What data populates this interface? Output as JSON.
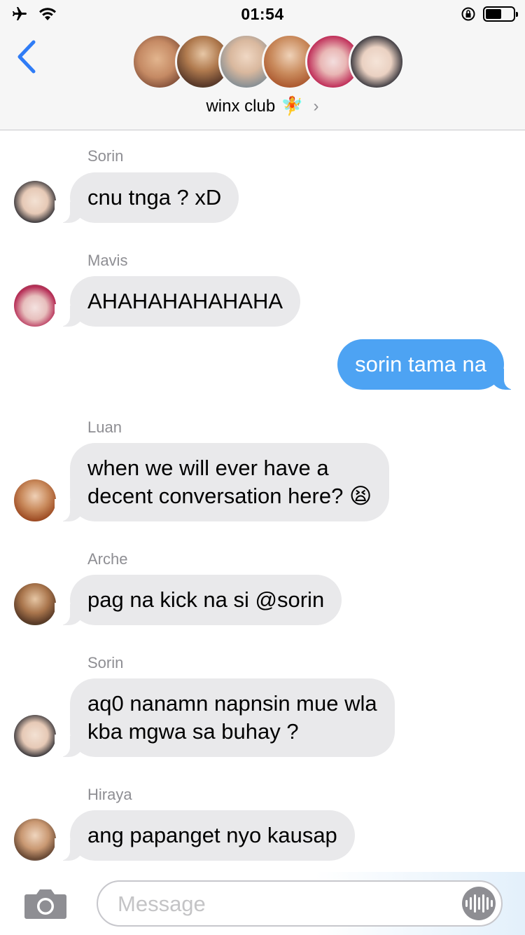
{
  "status_bar": {
    "time": "01:54",
    "icons": [
      "airplane-icon",
      "wifi-icon",
      "orientation-lock-icon",
      "battery-icon"
    ],
    "battery_level": 0.5
  },
  "header": {
    "group_name": "winx club",
    "group_emoji": "🧚",
    "chevron": "›",
    "member_count_shown": 6
  },
  "messages": [
    {
      "sender": "Sorin",
      "text": "cnu tnga ? xD",
      "direction": "incoming"
    },
    {
      "sender": "Mavis",
      "text": "AHAHAHAHAHAHA",
      "direction": "incoming"
    },
    {
      "sender": "",
      "text": "sorin tama na",
      "direction": "outgoing"
    },
    {
      "sender": "Luan",
      "text_line1": "when we will ever have a",
      "text_line2": "decent conversation here? 😫",
      "direction": "incoming"
    },
    {
      "sender": "Arche",
      "text": "pag na kick na si @sorin",
      "direction": "incoming"
    },
    {
      "sender": "Sorin",
      "text_line1": "aq0 nanamn napnsin mue wla",
      "text_line2": "kba mgwa sa buhay ?",
      "direction": "incoming"
    },
    {
      "sender": "Hiraya",
      "text": "ang papanget nyo kausap",
      "direction": "incoming"
    }
  ],
  "input": {
    "placeholder": "Message"
  },
  "colors": {
    "incoming_bubble": "#e9e9eb",
    "outgoing_bubble": "#4da3f3",
    "accent": "#2f7cf6",
    "header_bg": "#f6f6f6"
  }
}
